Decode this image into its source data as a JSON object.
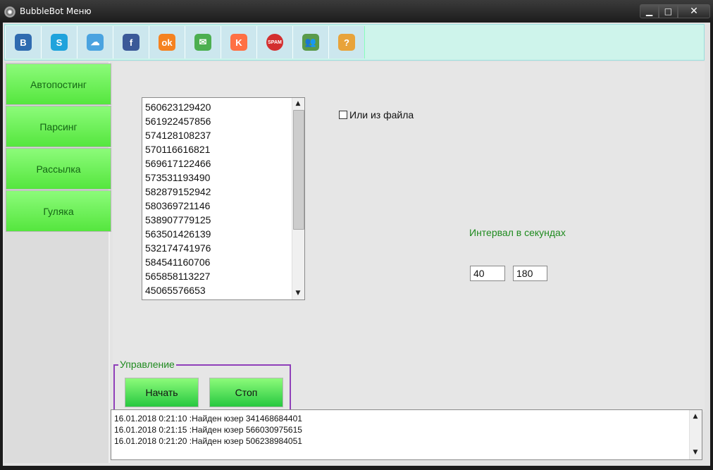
{
  "window": {
    "title": "BubbleBot Меню",
    "controls": {
      "minimize": "▁",
      "maximize": "□",
      "close": "✕"
    }
  },
  "toolbar": {
    "buttons": [
      {
        "id": "vk",
        "icon": "vk-icon",
        "glyph": "B",
        "color": "#2f6bb0"
      },
      {
        "id": "skype",
        "icon": "skype-icon",
        "glyph": "S",
        "color": "#1fa3dc"
      },
      {
        "id": "cloud",
        "icon": "cloud-icon",
        "glyph": "☁",
        "color": "#4aa3e0"
      },
      {
        "id": "facebook",
        "icon": "facebook-icon",
        "glyph": "f",
        "color": "#3b5998"
      },
      {
        "id": "odnoklassniki",
        "icon": "odnoklassniki-icon",
        "glyph": "ok",
        "color": "#f58220"
      },
      {
        "id": "mail",
        "icon": "mail-icon",
        "glyph": "✉",
        "color": "#4caf50"
      },
      {
        "id": "k-service",
        "icon": "k-icon",
        "glyph": "K",
        "color": "#ff7043"
      },
      {
        "id": "spam",
        "icon": "spam-stop-icon",
        "glyph": "SPAM",
        "color": "#d32f2f"
      },
      {
        "id": "users",
        "icon": "users-icon",
        "glyph": "👥",
        "color": "#5a9a4a"
      },
      {
        "id": "help",
        "icon": "help-book-icon",
        "glyph": "?",
        "color": "#e8a33a"
      }
    ]
  },
  "sidebar": {
    "items": [
      {
        "label": "Автопостинг"
      },
      {
        "label": "Парсинг"
      },
      {
        "label": "Рассылка"
      },
      {
        "label": "Гуляка"
      }
    ]
  },
  "id_list": {
    "items": [
      "560623129420",
      "561922457856",
      "574128108237",
      "570116616821",
      "569617122466",
      "573531193490",
      "582879152942",
      "580369721146",
      "538907779125",
      "563501426139",
      "532174741976",
      "584541160706",
      "565858113227",
      "45065576653"
    ]
  },
  "file_option": {
    "label": "Или из файла",
    "checked": false
  },
  "interval": {
    "label": "Интервал в секундах",
    "min": "40",
    "max": "180"
  },
  "controls_group": {
    "legend": "Управление",
    "start_label": "Начать",
    "stop_label": "Стоп"
  },
  "log": {
    "lines": [
      "16.01.2018 0:21:10 :Найден юзер 341468684401",
      "16.01.2018 0:21:15 :Найден юзер 566030975615",
      "16.01.2018 0:21:20 :Найден юзер 506238984051"
    ]
  },
  "scroll": {
    "up": "▲",
    "down": "▼"
  }
}
